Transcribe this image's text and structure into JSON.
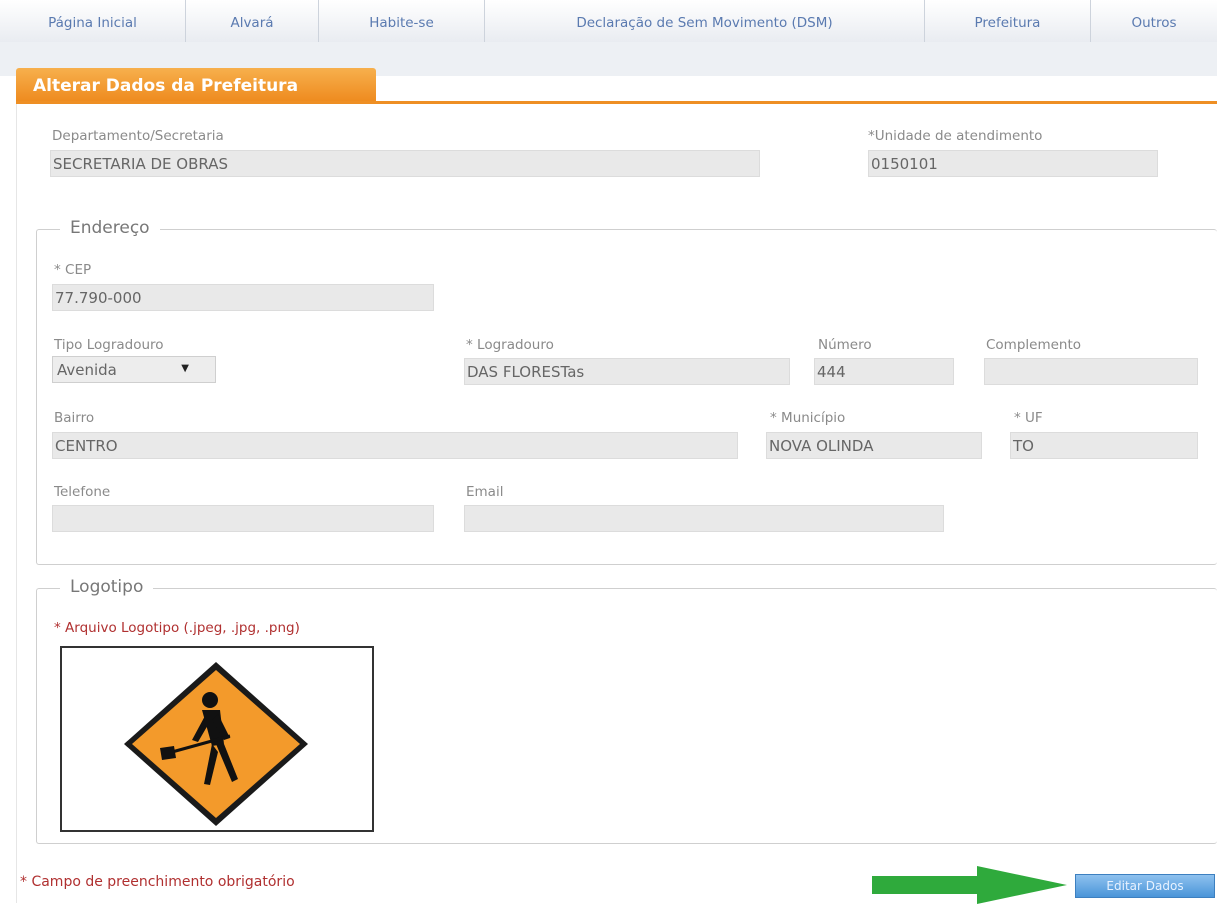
{
  "nav": {
    "items": [
      "Página Inicial",
      "Alvará",
      "Habite-se",
      "Declaração de Sem Movimento (DSM)",
      "Prefeitura",
      "Outros"
    ]
  },
  "panel": {
    "title": "Alterar Dados da Prefeitura"
  },
  "top_fields": {
    "departamento_label": "Departamento/Secretaria",
    "departamento_value": "SECRETARIA DE OBRAS",
    "unidade_label": "*Unidade de atendimento",
    "unidade_value": "0150101"
  },
  "endereco": {
    "legend": "Endereço",
    "cep_label": "* CEP",
    "cep_value": "77.790-000",
    "tipo_logradouro_label": "Tipo Logradouro",
    "tipo_logradouro_value": "Avenida",
    "logradouro_label": "* Logradouro",
    "logradouro_value": "DAS FLORESTas",
    "numero_label": "Número",
    "numero_value": "444",
    "complemento_label": "Complemento",
    "complemento_value": "",
    "bairro_label": "Bairro",
    "bairro_value": "CENTRO",
    "municipio_label": "* Município",
    "municipio_value": "NOVA OLINDA",
    "uf_label": "* UF",
    "uf_value": "TO",
    "telefone_label": "Telefone",
    "telefone_value": "",
    "email_label": "Email",
    "email_value": ""
  },
  "logotipo": {
    "legend": "Logotipo",
    "arquivo_label": "* Arquivo Logotipo (.jpeg, .jpg, .png)",
    "image_icon": "road-work-sign-icon"
  },
  "footer": {
    "required_note": "* Campo de preenchimento obrigatório",
    "button_label": "Editar Dados"
  },
  "colors": {
    "accent_orange": "#ee8a1e",
    "nav_text": "#5a7ab0",
    "button_blue": "#4a95d9",
    "arrow_green": "#2faa3c",
    "required_red": "#b03030"
  }
}
